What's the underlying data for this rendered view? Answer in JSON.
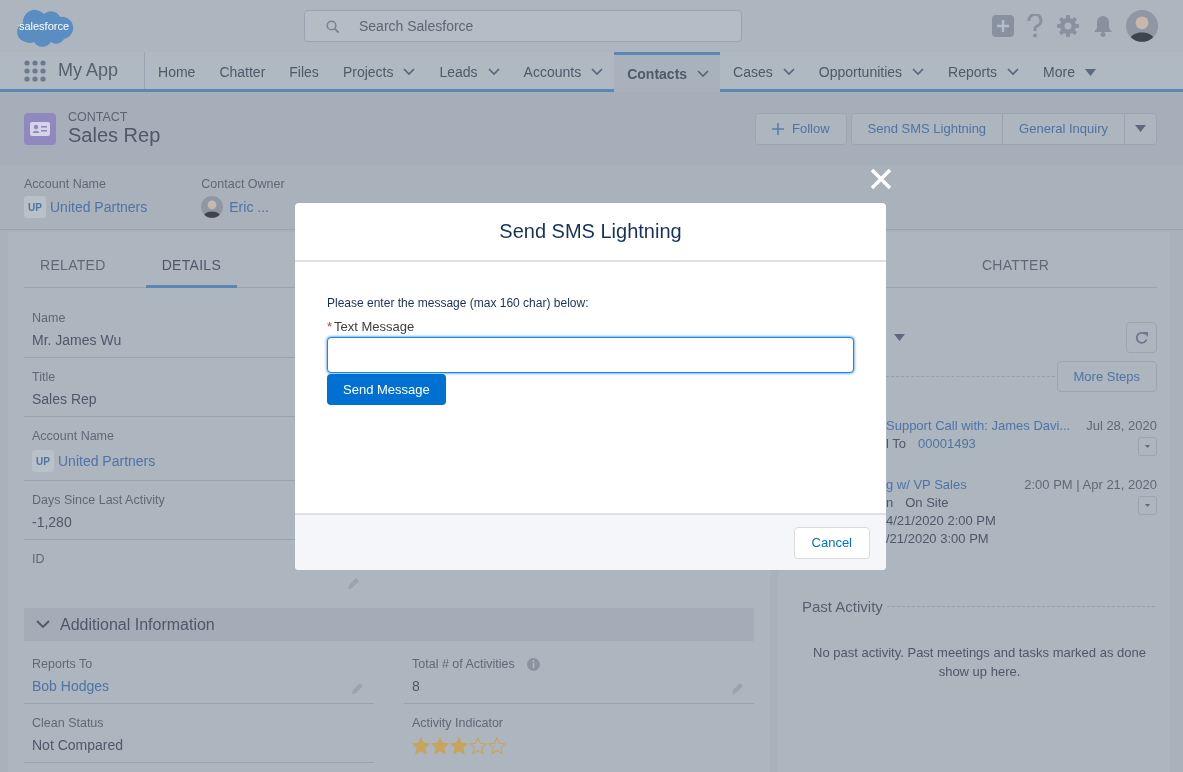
{
  "header": {
    "logo_text": "salesforce",
    "search": {
      "placeholder": "Search Salesforce"
    }
  },
  "nav": {
    "app_name": "My App",
    "items": [
      {
        "label": "Home",
        "kind": "link",
        "selected": false
      },
      {
        "label": "Chatter",
        "kind": "link",
        "selected": false
      },
      {
        "label": "Files",
        "kind": "link",
        "selected": false
      },
      {
        "label": "Projects",
        "kind": "menu",
        "selected": false
      },
      {
        "label": "Leads",
        "kind": "menu",
        "selected": false
      },
      {
        "label": "Accounts",
        "kind": "menu",
        "selected": false
      },
      {
        "label": "Contacts",
        "kind": "menu",
        "selected": true
      },
      {
        "label": "Cases",
        "kind": "menu",
        "selected": false
      },
      {
        "label": "Opportunities",
        "kind": "menu",
        "selected": false
      },
      {
        "label": "Reports",
        "kind": "menu",
        "selected": false
      },
      {
        "label": "More",
        "kind": "more",
        "selected": false
      }
    ]
  },
  "record": {
    "object_type": "CONTACT",
    "title": "Sales Rep",
    "actions": [
      {
        "label": "Follow",
        "kind": "follow"
      },
      {
        "label": "Send SMS Lightning",
        "kind": "action"
      },
      {
        "label": "General Inquiry",
        "kind": "action"
      },
      {
        "kind": "menu"
      }
    ]
  },
  "highlights": [
    {
      "label": "Account Name",
      "value": "United Partners",
      "kind": "account",
      "logo_text": "UP"
    },
    {
      "label": "Contact Owner",
      "value": "Eric ...",
      "kind": "user"
    }
  ],
  "details": {
    "tabs": [
      {
        "label": "RELATED",
        "selected": false
      },
      {
        "label": "DETAILS",
        "selected": true
      }
    ],
    "fields": [
      {
        "label": "Name",
        "value": "Mr. James Wu",
        "kind": "text"
      },
      {
        "label": "Title",
        "value": "Sales Rep",
        "kind": "text"
      },
      {
        "label": "Account Name",
        "value": "United Partners",
        "kind": "account",
        "logo_text": "UP"
      },
      {
        "label": "Days Since Last Activity",
        "value": "-1,280",
        "kind": "text"
      },
      {
        "label": "ID",
        "kind": "text",
        "editable": true
      }
    ],
    "section": {
      "title": "Additional Information",
      "expanded": true
    },
    "section_fields": [
      {
        "label": "Reports To",
        "value": "Bob Hodges",
        "kind": "link",
        "editable": true
      },
      {
        "label": "Total # of Activities",
        "value": "8",
        "kind": "text",
        "info": true,
        "editable": true
      },
      {
        "label": "Clean Status",
        "value": "Not Compared",
        "kind": "text"
      },
      {
        "label": "Activity Indicator",
        "kind": "stars",
        "stars": 3
      }
    ]
  },
  "activity": {
    "tabs": [
      {
        "label": "CHATTER",
        "selected": false
      }
    ],
    "more_steps": "More Steps",
    "items": [
      {
        "title": "Support Call with: James Davi...",
        "date": "Jul 28, 2020",
        "lines": [
          [
            {
              "text": "l To",
              "link": false
            },
            {
              "text": "00001493",
              "link": true
            }
          ]
        ]
      },
      {
        "title": "g w/ VP Sales",
        "date": "2:00 PM | Apr 21, 2020",
        "lines": [
          [
            {
              "text": "n",
              "link": false
            },
            {
              "text": "On Site",
              "link": false
            }
          ],
          [
            {
              "text": "4/21/2020 2:00 PM",
              "link": false
            }
          ],
          [
            {
              "text": "/21/2020 3:00 PM",
              "link": false
            }
          ]
        ]
      }
    ],
    "past_title": "Past Activity",
    "past_empty": "No past activity. Past meetings and tasks marked as done show up here."
  },
  "modal": {
    "title": "Send SMS Lightning",
    "instructions": "Please enter the message (max 160 char) below:",
    "field": {
      "label": "Text Message",
      "required_mark": "*",
      "required": true
    },
    "submit": "Send Message",
    "cancel": "Cancel"
  }
}
